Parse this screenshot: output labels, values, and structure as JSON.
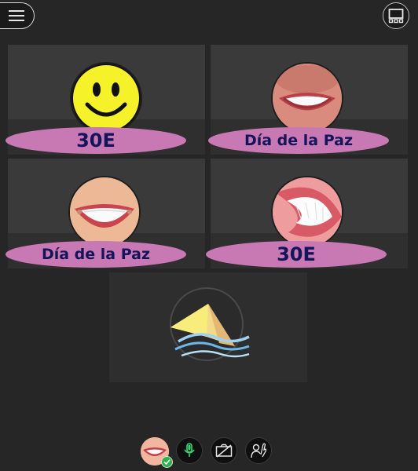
{
  "toolbar": {
    "menu_icon": "hamburger-icon",
    "layout_icon": "layout-icon"
  },
  "participants": [
    {
      "name": "30E",
      "avatar": "smiley-face"
    },
    {
      "name": "Día de la Paz",
      "avatar": "smile-mouth"
    },
    {
      "name": "Día de la Paz",
      "avatar": "smile-mouth-wide"
    },
    {
      "name": "30E",
      "avatar": "smile-teeth"
    }
  ],
  "presenter": {
    "avatar": "paper-plane-wind-logo"
  },
  "controls": {
    "self_avatar": "smile-avatar",
    "status_icon": "check-icon",
    "mic_icon": "microphone-icon",
    "camera_icon": "camera-off-icon",
    "hand_icon": "raise-hand-icon"
  },
  "colors": {
    "background": "#262626",
    "tile": "#3a3a3a",
    "name_pill": "#c879b4",
    "name_text": "#14145a",
    "mic_active": "#3bd16f",
    "status_ok": "#2fb24a"
  }
}
